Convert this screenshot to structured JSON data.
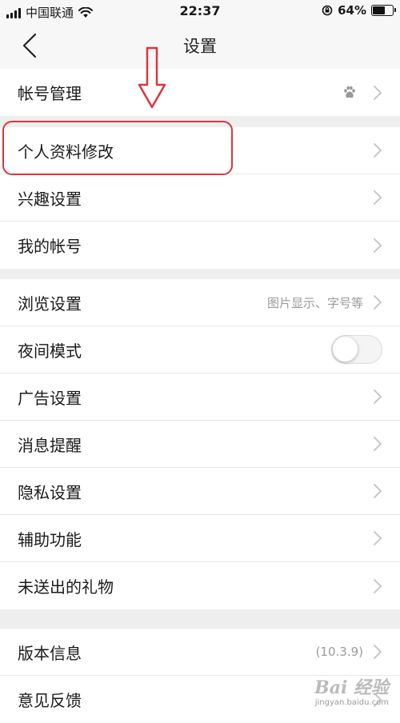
{
  "status_bar": {
    "carrier": "中国联通",
    "time": "22:37",
    "battery": "64%",
    "battery_level": 0.64
  },
  "nav": {
    "title": "设置",
    "back_icon": "chevron-left-icon"
  },
  "groups": [
    {
      "items": [
        {
          "label": "帐号管理",
          "icon": "baidu-paw-icon"
        }
      ]
    },
    {
      "items": [
        {
          "label": "个人资料修改"
        },
        {
          "label": "兴趣设置"
        },
        {
          "label": "我的帐号"
        }
      ]
    },
    {
      "items": [
        {
          "label": "浏览设置",
          "hint": "图片显示、字号等"
        },
        {
          "label": "夜间模式",
          "toggle": false
        },
        {
          "label": "广告设置"
        },
        {
          "label": "消息提醒"
        },
        {
          "label": "隐私设置"
        },
        {
          "label": "辅助功能"
        },
        {
          "label": "未送出的礼物"
        }
      ]
    },
    {
      "items": [
        {
          "label": "版本信息",
          "hint": "(10.3.9)"
        },
        {
          "label": "意见反馈"
        }
      ]
    }
  ],
  "watermark": {
    "logo": "Bai 经验",
    "url": "jingyan.baidu.com"
  },
  "colors": {
    "highlight": "#d9363e",
    "background": "#eeeeee"
  }
}
